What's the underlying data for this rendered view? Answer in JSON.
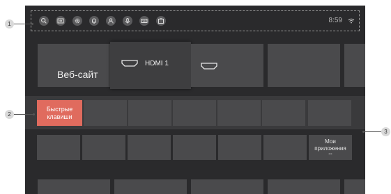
{
  "status_bar": {
    "icons": [
      "search-icon",
      "input-source-icon",
      "settings-icon",
      "notification-icon",
      "profile-icon",
      "voice-assistant-icon",
      "keyboard-icon",
      "media-icon"
    ],
    "time": "8:59",
    "wifi_icon": "wifi-icon"
  },
  "top_row": {
    "website_label": "Веб-сайт",
    "hdmi1_label": "HDMI 1"
  },
  "shortcuts": {
    "label_line1": "Быстрые",
    "label_line2": "клавиши",
    "accent_color": "#e06b5e"
  },
  "apps": {
    "my_apps_line1": "Мои",
    "my_apps_line2": "приложения",
    "my_apps_dots": "•••"
  },
  "callouts": [
    "1",
    "2",
    "3"
  ]
}
